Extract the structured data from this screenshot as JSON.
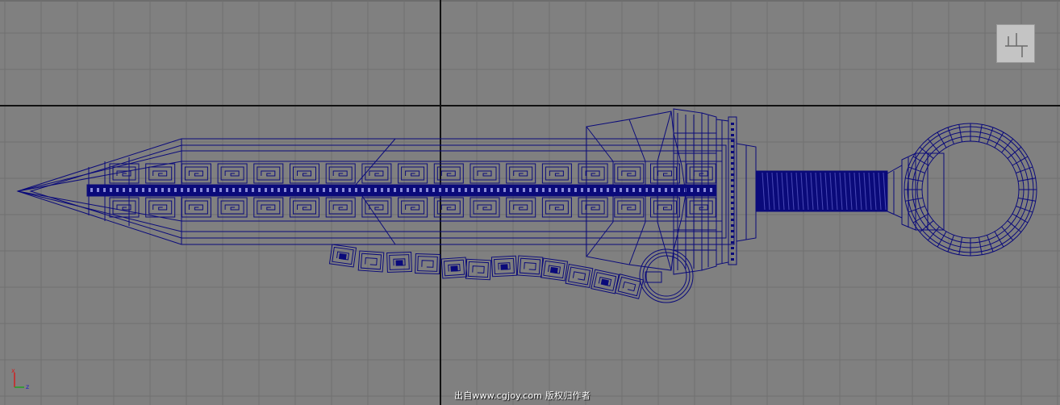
{
  "viewport": {
    "view": "top orthographic",
    "background_color": "#808080",
    "grid_line_color": "#707070",
    "axis_line_color": "#111111",
    "wireframe_color": "#0a0a7a",
    "grid": "on"
  },
  "model": {
    "type": "sword wireframe",
    "parts": [
      "blade",
      "fuller-pattern",
      "guard",
      "grip",
      "pommel-ring",
      "tassel-chain",
      "small-ring"
    ]
  },
  "view_cube": {
    "icon": "view-cube-icon"
  },
  "axis_gizmo": {
    "icon": "axis-gizmo-icon",
    "x_color": "#d02020",
    "y_color": "#20a020",
    "z_label": "z"
  },
  "watermark": {
    "text": "出自www.cgjoy.com 版权归作者"
  }
}
